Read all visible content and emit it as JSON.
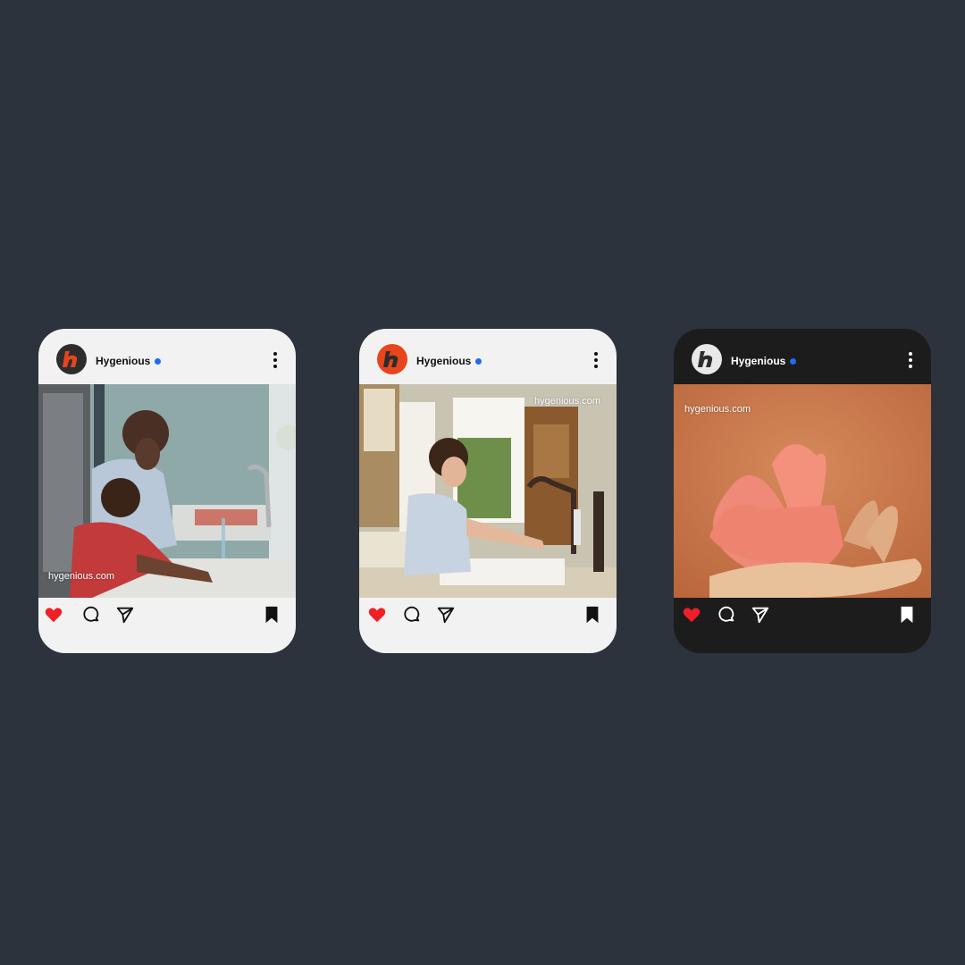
{
  "posts": [
    {
      "username": "Hygenious",
      "watermark": "hygenious.com",
      "theme": "light"
    },
    {
      "username": "Hygenious",
      "watermark": "hygenious.com",
      "theme": "light"
    },
    {
      "username": "Hygenious",
      "watermark": "hygenious.com",
      "theme": "dark"
    }
  ],
  "icons": {
    "like": "heart-icon",
    "comment": "comment-icon",
    "share": "send-icon",
    "save": "bookmark-icon",
    "more": "more-vertical-icon",
    "verified": "verified-badge-icon"
  },
  "colors": {
    "background": "#2c333c",
    "like": "#f01f27",
    "verified": "#1d6cf2",
    "brand": "#e8451d"
  }
}
